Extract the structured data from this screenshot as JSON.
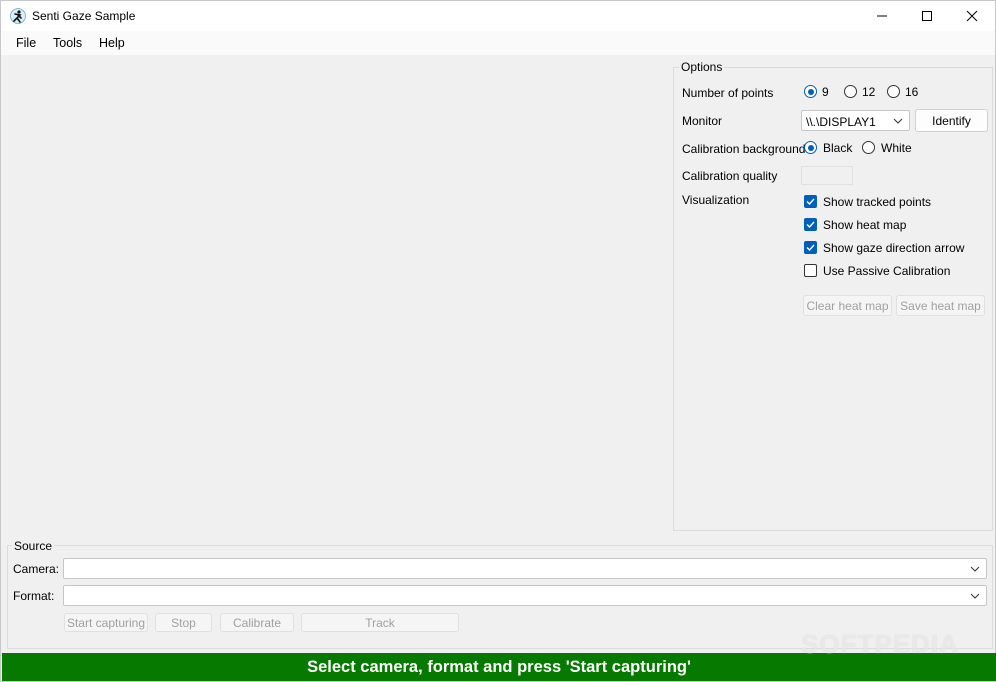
{
  "window": {
    "title": "Senti Gaze Sample"
  },
  "menu": {
    "items": [
      "File",
      "Tools",
      "Help"
    ]
  },
  "options": {
    "group_label": "Options",
    "points_label": "Number of points",
    "points_options": [
      "9",
      "12",
      "16"
    ],
    "points_selected": "9",
    "monitor_label": "Monitor",
    "monitor_value": "\\\\.\\DISPLAY1",
    "identify_label": "Identify",
    "calibration_bg_label": "Calibration background",
    "calibration_bg_options": [
      "Black",
      "White"
    ],
    "calibration_bg_selected": "Black",
    "calibration_quality_label": "Calibration quality",
    "visualization_label": "Visualization",
    "visualization_items": [
      {
        "label": "Show tracked points",
        "checked": true
      },
      {
        "label": "Show heat map",
        "checked": true
      },
      {
        "label": "Show gaze direction arrow",
        "checked": true
      },
      {
        "label": "Use Passive Calibration",
        "checked": false
      }
    ],
    "clear_heat_map_label": "Clear heat map",
    "save_heat_map_label": "Save heat map"
  },
  "source": {
    "group_label": "Source",
    "camera_label": "Camera:",
    "camera_value": "",
    "format_label": "Format:",
    "format_value": "",
    "start_capturing_label": "Start capturing",
    "stop_label": "Stop",
    "calibrate_label": "Calibrate",
    "track_label": "Track"
  },
  "status": {
    "message": "Select camera, format and press 'Start capturing'"
  },
  "watermark": "SOFTPEDIA",
  "colors": {
    "accent": "#005fb8",
    "status_bg": "#067a00"
  }
}
